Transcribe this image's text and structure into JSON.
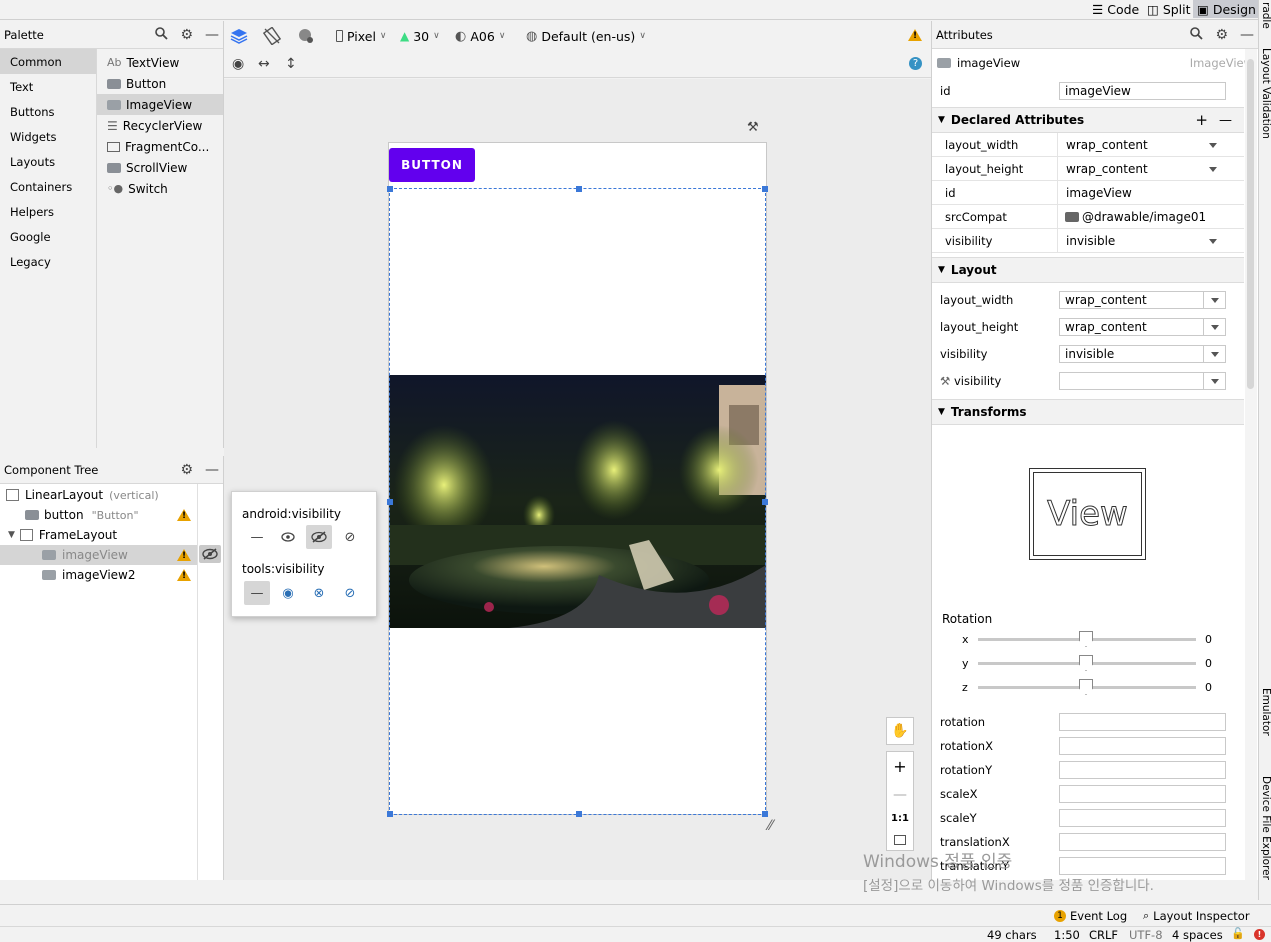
{
  "mode_bar": {
    "code": "Code",
    "split": "Split",
    "design": "Design"
  },
  "palette": {
    "title": "Palette",
    "categories": [
      "Common",
      "Text",
      "Buttons",
      "Widgets",
      "Layouts",
      "Containers",
      "Helpers",
      "Google",
      "Legacy"
    ],
    "selected_category": "Common",
    "items": [
      {
        "prefix": "Ab",
        "label": "TextView"
      },
      {
        "prefix": "",
        "label": "Button"
      },
      {
        "prefix": "",
        "label": "ImageView"
      },
      {
        "prefix": "",
        "label": "RecyclerView"
      },
      {
        "prefix": "",
        "label": "FragmentCo..."
      },
      {
        "prefix": "",
        "label": "ScrollView"
      },
      {
        "prefix": "",
        "label": "Switch"
      }
    ]
  },
  "component_tree": {
    "title": "Component Tree",
    "nodes": [
      {
        "label": "LinearLayout",
        "hint": "(vertical)"
      },
      {
        "label": "button",
        "hint": "\"Button\""
      },
      {
        "label": "FrameLayout",
        "hint": ""
      },
      {
        "label": "imageView",
        "hint": ""
      },
      {
        "label": "imageView2",
        "hint": ""
      }
    ]
  },
  "visibility_popup": {
    "android_label": "android:visibility",
    "tools_label": "tools:visibility"
  },
  "design_toolbar": {
    "device": "Pixel",
    "api": "30",
    "theme": "A06",
    "locale": "Default (en-us)"
  },
  "canvas": {
    "button_text": "BUTTON",
    "zoom_ratio": "1:1"
  },
  "attributes": {
    "title": "Attributes",
    "component_name": "imageView",
    "component_type": "ImageView",
    "id_label": "id",
    "id_value": "imageView",
    "declared_title": "Declared Attributes",
    "declared": [
      {
        "name": "layout_width",
        "value": "wrap_content"
      },
      {
        "name": "layout_height",
        "value": "wrap_content"
      },
      {
        "name": "id",
        "value": "imageView"
      },
      {
        "name": "srcCompat",
        "value": "@drawable/image01"
      },
      {
        "name": "visibility",
        "value": "invisible"
      }
    ],
    "layout_title": "Layout",
    "layout": [
      {
        "name": "layout_width",
        "value": "wrap_content"
      },
      {
        "name": "layout_height",
        "value": "wrap_content"
      },
      {
        "name": "visibility",
        "value": "invisible"
      },
      {
        "name": "visibility",
        "value": ""
      }
    ],
    "transforms_title": "Transforms",
    "view_preview": "View",
    "rotation_title": "Rotation",
    "rotation": [
      {
        "axis": "x",
        "value": "0"
      },
      {
        "axis": "y",
        "value": "0"
      },
      {
        "axis": "z",
        "value": "0"
      }
    ],
    "transform_fields": [
      "rotation",
      "rotationX",
      "rotationY",
      "scaleX",
      "scaleY",
      "translationX",
      "translationY"
    ]
  },
  "right_strip": {
    "gradle": "radle",
    "layout_validation": "Layout Validation",
    "emulator": "Emulator",
    "device_file_explorer": "Device File Explorer"
  },
  "bottom_bar": {
    "event_log": "Event Log",
    "event_count": "1",
    "layout_inspector": "Layout Inspector"
  },
  "status_bar": {
    "chars": "49 chars",
    "position": "1:50",
    "line_ending": "CRLF",
    "encoding": "UTF-8",
    "indent": "4 spaces"
  },
  "watermark": {
    "line1": "Windows 정품 인증",
    "line2": "[설정]으로 이동하여 Windows를 정품 인증합니다."
  },
  "colors": {
    "accent": "#6200ee",
    "selection": "#3b78d8",
    "warning": "#e8a200"
  }
}
